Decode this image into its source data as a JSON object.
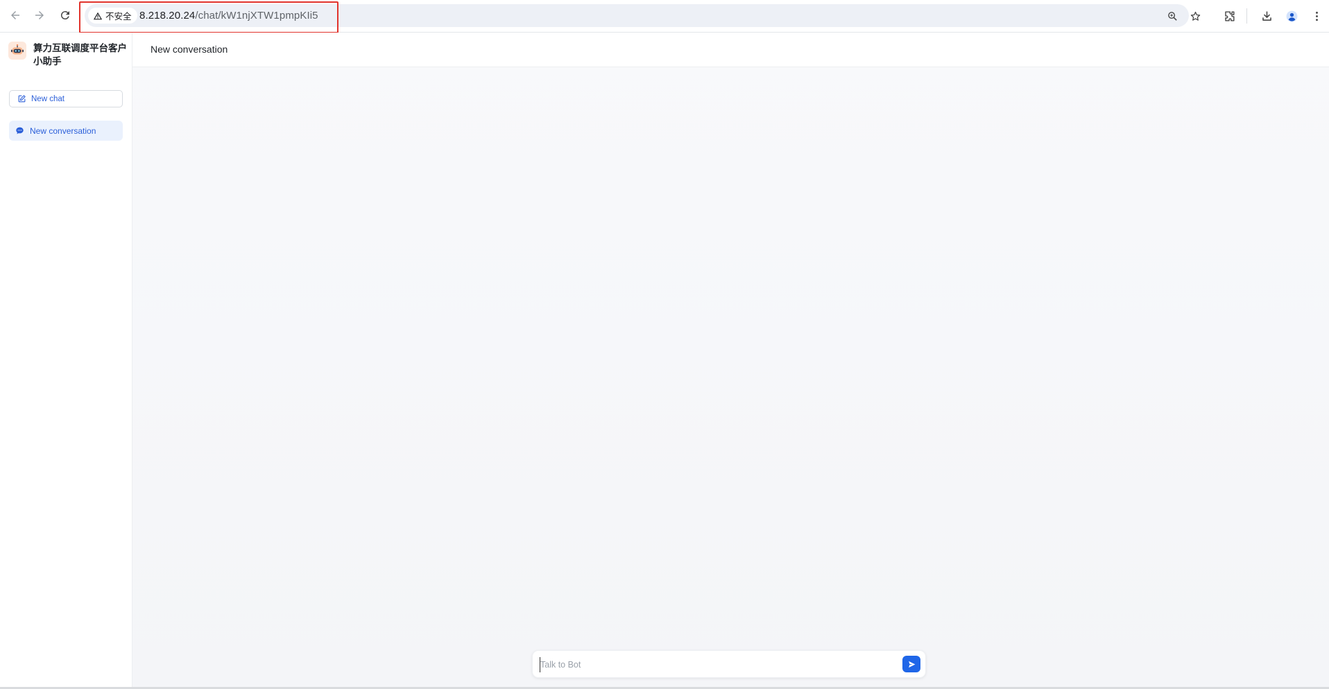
{
  "browser": {
    "security_label": "不安全",
    "url_host": "8.218.20.24",
    "url_path": "/chat/kW1njXTW1pmpKIi5"
  },
  "sidebar": {
    "brand_name": "算力互联调度平台客户小助手",
    "new_chat_label": "New chat",
    "conversations": [
      {
        "label": "New conversation"
      }
    ]
  },
  "main": {
    "title": "New conversation",
    "composer": {
      "placeholder": "Talk to Bot",
      "value": ""
    }
  },
  "colors": {
    "accent": "#1f66e8",
    "active_item_bg": "#eaf1fd",
    "highlight_box": "#e1332c"
  },
  "icons": {
    "back": "back-arrow-icon",
    "forward": "forward-arrow-icon",
    "reload": "reload-icon",
    "warning": "warning-triangle-icon",
    "zoom": "zoom-icon",
    "bookmark": "star-icon",
    "extensions": "puzzle-icon",
    "downloads": "download-icon",
    "profile": "profile-icon",
    "menu": "kebab-menu-icon",
    "logo": "robot-logo-icon",
    "new_chat": "edit-icon",
    "conversation": "chat-bubble-icon",
    "send": "send-icon"
  }
}
